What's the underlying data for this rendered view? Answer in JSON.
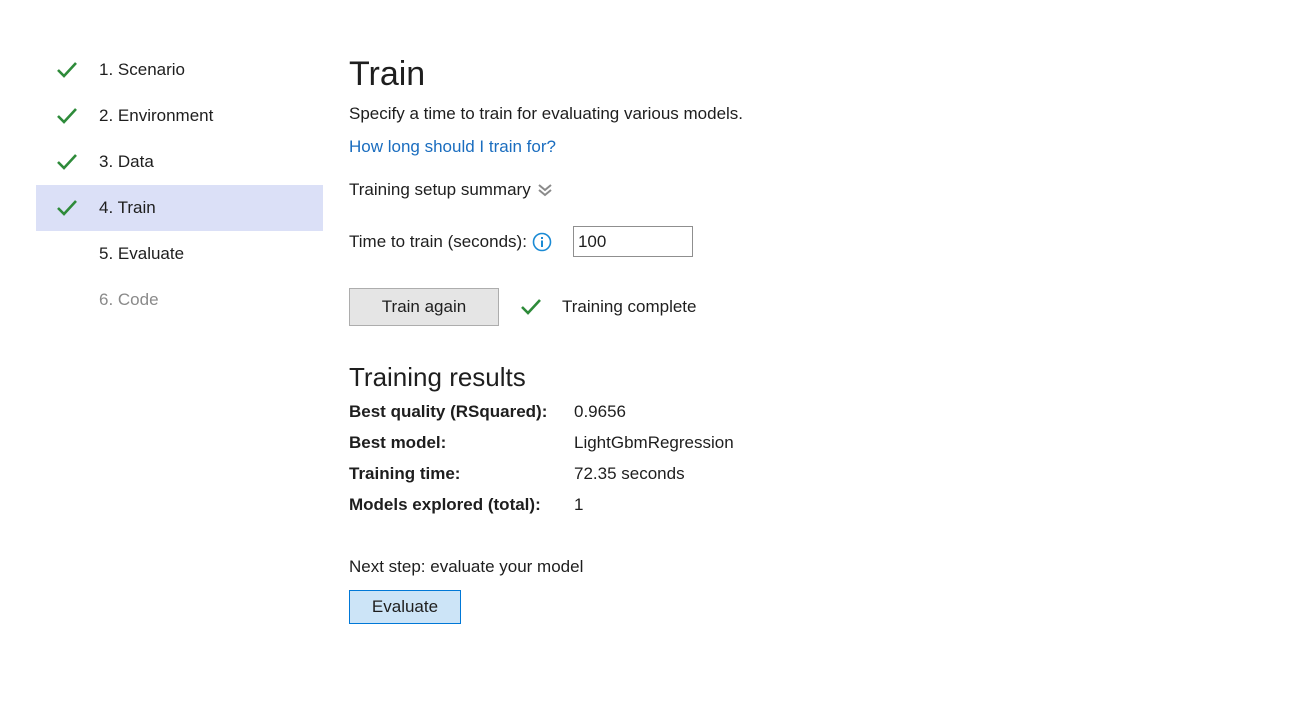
{
  "sidebar": {
    "steps": [
      {
        "label": "1. Scenario",
        "state": "complete"
      },
      {
        "label": "2. Environment",
        "state": "complete"
      },
      {
        "label": "3. Data",
        "state": "complete"
      },
      {
        "label": "4. Train",
        "state": "active-complete"
      },
      {
        "label": "5. Evaluate",
        "state": "pending"
      },
      {
        "label": "6. Code",
        "state": "disabled"
      }
    ]
  },
  "main": {
    "title": "Train",
    "subtitle": "Specify a time to train for evaluating various models.",
    "help_link": "How long should I train for?",
    "summary_toggle": "Training setup summary",
    "time_label": "Time to train (seconds):",
    "time_value": "100",
    "train_button": "Train again",
    "status_text": "Training complete",
    "results_heading": "Training results",
    "results": [
      {
        "key": "Best quality (RSquared):",
        "value": "0.9656"
      },
      {
        "key": "Best model:",
        "value": "LightGbmRegression"
      },
      {
        "key": "Training time:",
        "value": "72.35 seconds"
      },
      {
        "key": "Models explored (total):",
        "value": "1"
      }
    ],
    "next_step": "Next step: evaluate your model",
    "evaluate_button": "Evaluate"
  },
  "icons": {
    "check": "check-icon",
    "info": "info-icon",
    "chevron": "double-chevron-down-icon"
  },
  "colors": {
    "check_green": "#2e8b3a",
    "link_blue": "#1a6dbf",
    "active_step_bg": "#dbe0f7",
    "info_blue": "#1a8ad4",
    "evaluate_bg": "#cce4f7",
    "evaluate_border": "#0078d7"
  }
}
